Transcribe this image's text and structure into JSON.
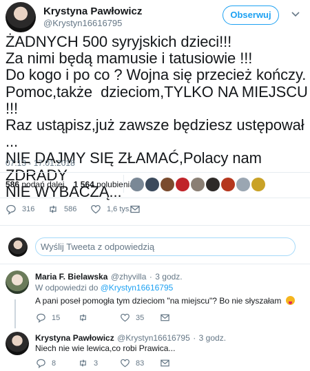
{
  "tweet": {
    "author_name": "Krystyna Pawłowicz",
    "author_handle": "@Krystyn16616795",
    "follow_label": "Obserwuj",
    "text": "ŻADNYCH 500 syryjskich dzieci!!!\nZa nimi będą mamusie i tatusiowie !!!\nDo kogo i po co ? Wojna się przecież kończy.\nPomoc,także  dzieciom,TYLKO NA MIEJSCU !!!\nRaz ustąpisz,już zawsze będziesz ustępował ...\nNIE DAJMY SIĘ ZŁAMAĆ,Polacy nam ZDRADY\nNIE WYBACZĄ...",
    "timestamp": "07:13 - 17.01.2018"
  },
  "stats": {
    "retweets_count": "586",
    "retweets_label": "podań dalej",
    "likes_count": "1 564",
    "likes_label": "polubienia"
  },
  "actions": {
    "reply_count": "316",
    "retweet_count": "586",
    "like_count": "1,6 tys."
  },
  "reply_box": {
    "placeholder": "Wyślij Tweeta z odpowiedzią"
  },
  "replies": [
    {
      "name": "Maria F. Bielawska",
      "handle": "@zhyvilla",
      "time": "3 godz.",
      "reply_to_prefix": "W odpowiedzi do",
      "reply_to_handle": "@Krystyn16616795",
      "text": "A pani poseł pomogła tym dzieciom \"na miejscu\"? Bo nie słyszałam",
      "reply_count": "15",
      "retweet_count": "",
      "like_count": "35"
    },
    {
      "name": "Krystyna Pawłowicz",
      "handle": "@Krystyn16616795",
      "time": "3 godz.",
      "text": "Niech nie wie lewica,co robi Prawica...",
      "reply_count": "8",
      "retweet_count": "3",
      "like_count": "83"
    }
  ],
  "colors": {
    "accent": "#1da1f2",
    "muted": "#657786",
    "divider": "#e6ecf0"
  }
}
